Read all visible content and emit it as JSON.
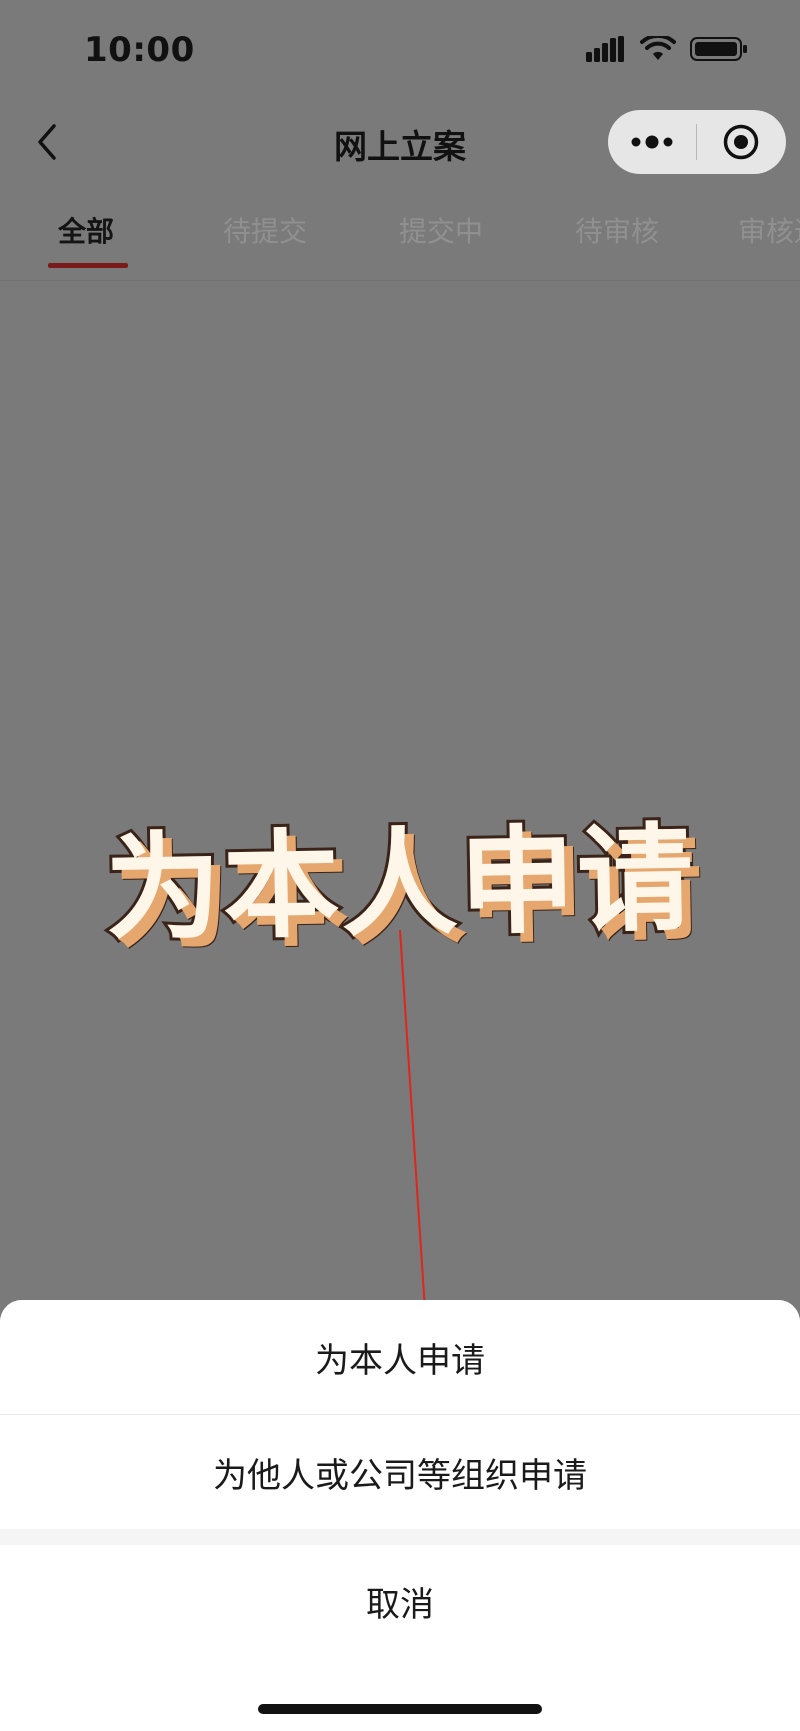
{
  "status_bar": {
    "time": "10:00"
  },
  "nav": {
    "title": "网上立案"
  },
  "tabs": [
    {
      "label": "全部",
      "active": true
    },
    {
      "label": "待提交",
      "active": false
    },
    {
      "label": "提交中",
      "active": false
    },
    {
      "label": "待审核",
      "active": false
    },
    {
      "label": "审核通",
      "active": false
    }
  ],
  "overlay": {
    "headline": "为本人申请"
  },
  "action_sheet": {
    "option_self": "为本人申请",
    "option_other": "为他人或公司等组织申请",
    "cancel": "取消"
  },
  "colors": {
    "dim_background": "#7a7a7a",
    "tab_active_underline": "#7b1a1a",
    "arrow": "#e0261a",
    "headline_fill": "#fff6ea",
    "headline_shadow": "#e6a76e"
  },
  "icons": {
    "back": "chevron-left-icon",
    "more": "more-dots-icon",
    "close": "target-close-icon",
    "signal": "signal-icon",
    "wifi": "wifi-icon",
    "battery": "battery-icon"
  }
}
